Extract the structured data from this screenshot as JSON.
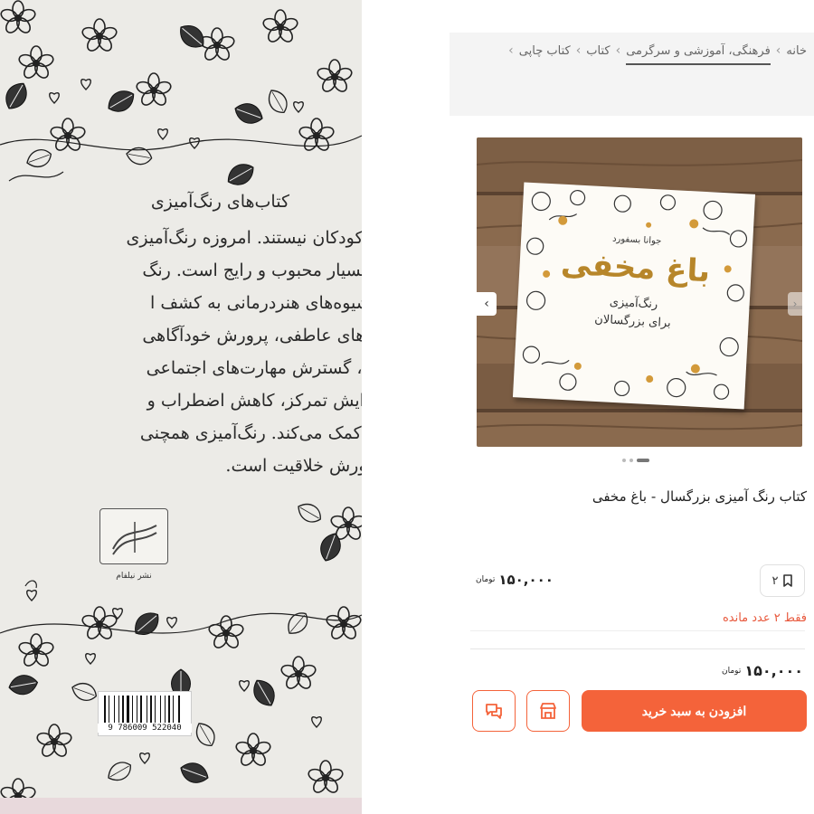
{
  "back_cover": {
    "heading": "کتاب‌های رنگ‌آمیزی",
    "lines": [
      "دیگر مخصوص کودکان نیستند. امروزه رنگ‌آمیزی",
      "بزرگسالان نیز بسیار محبوب و رایج است. رنگ‌",
      "عنوان یکی از شیوه‌های هنردرمانی به کشف ا",
      "تسکین درگیری‌های عاطفی، پرورش خودآگاهی",
      "رفتار و عادت‌ها، گسترش مهارت‌های اجتماعی",
      "واقعگرایی، افزایش تمرکز، کاهش اضطراب و",
      "اعتماد به نفس کمک می‌کند. رنگ‌آمیزی همچنی",
      "برای ابراز و پرورش خلاقیت است."
    ],
    "publisher": "نشر نیلفام",
    "barcode_number": "9 786009 522040"
  },
  "breadcrumb": {
    "items": [
      "خانه",
      "فرهنگی، آموزشی و سرگرمی",
      "کتاب",
      "کتاب چاپی"
    ],
    "separator": "›"
  },
  "gallery": {
    "book_author": "جوانا بسفورد",
    "book_title": "باغ مخفی",
    "book_subtitle_1": "رنگ‌آمیزی",
    "book_subtitle_2": "برای بزرگسالان",
    "prev_icon": "chevron-left-icon",
    "next_icon": "chevron-right-icon",
    "slide_count": 3,
    "active_slide": 3
  },
  "product": {
    "title": "کتاب رنگ آمیزی بزرگسال - باغ مخفی",
    "bookmark_count": "۲",
    "price": "۱۵۰,۰۰۰",
    "currency": "تومان",
    "stock_note": "فقط ۲ عدد مانده",
    "final_price": "۱۵۰,۰۰۰",
    "final_currency": "تومان"
  },
  "actions": {
    "add_to_cart": "افزودن به سبد خرید",
    "store_icon": "store-icon",
    "chat_icon": "chat-icon"
  },
  "colors": {
    "accent": "#f4633a",
    "stock_warning": "#e8583c",
    "book_title": "#b7862a"
  }
}
